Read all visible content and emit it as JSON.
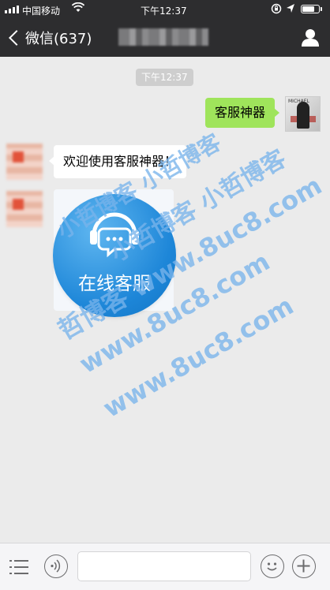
{
  "status_bar": {
    "carrier": "中国移动",
    "time": "下午12:37",
    "battery_level": 0.8
  },
  "nav": {
    "back_label": "微信(637)",
    "title": "",
    "profile_icon": "person-icon"
  },
  "chat": {
    "timestamp": "下午12:37",
    "messages": [
      {
        "from": "me",
        "text": "客服神器"
      },
      {
        "from": "them",
        "text": "欢迎使用客服神器！"
      },
      {
        "from": "them",
        "type": "image",
        "caption": "在线客服"
      }
    ]
  },
  "watermarks": [
    "小哲博客 小哲博客",
    "小哲博客 小哲博客",
    "哲博客 www.8uc8.com",
    "www.8uc8.com",
    "www.8uc8.com"
  ],
  "bottom_bar": {
    "icons": [
      "menu-icon",
      "voice-icon",
      "emoji-icon",
      "plus-icon"
    ]
  },
  "colors": {
    "bar_dark": "#2d2d2f",
    "chat_bg": "#ebebeb",
    "bubble_out": "#9fe45b",
    "bubble_in": "#ffffff",
    "service_blue": "#1d86d8"
  }
}
